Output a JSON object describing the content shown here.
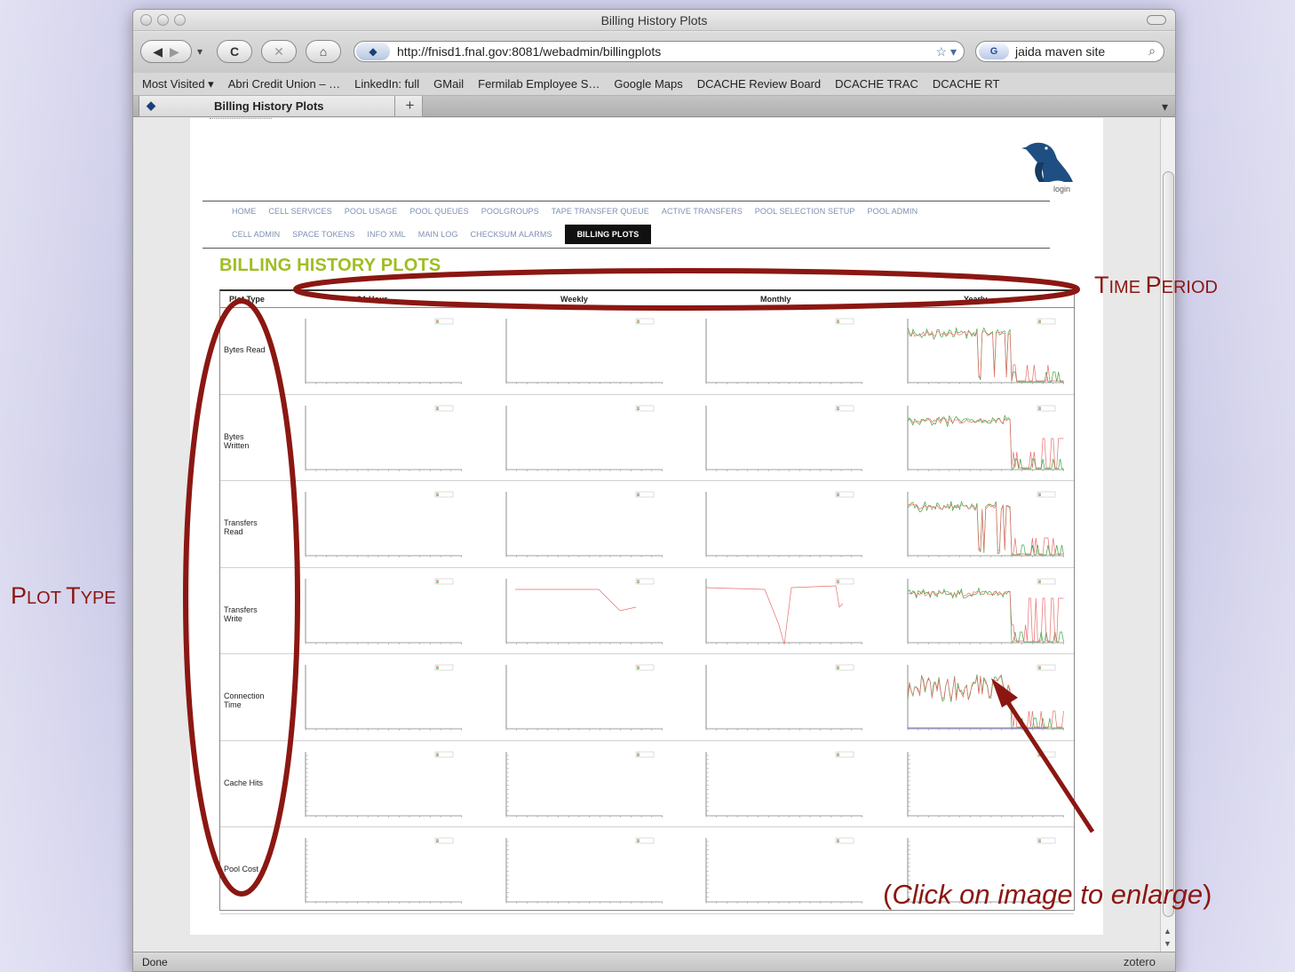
{
  "window": {
    "title": "Billing History Plots"
  },
  "toolbar": {
    "back_glyph": "◀",
    "forward_glyph": "▶",
    "history_glyph": "▾",
    "reload_glyph": "C",
    "stop_glyph": "✕",
    "home_glyph": "⌂",
    "url": "http://fnisd1.fnal.gov:8081/webadmin/billingplots",
    "bookmark_glyph": "☆ ▾",
    "search_engine": "G",
    "search_value": "jaida maven site",
    "search_glyph": "⌕"
  },
  "bookmarks": [
    "Most Visited ▾",
    "Abri Credit Union – …",
    "LinkedIn: full",
    "GMail",
    "Fermilab Employee S…",
    "Google Maps",
    "DCACHE Review Board",
    "DCACHE TRAC",
    "DCACHE RT"
  ],
  "tab": {
    "label": "Billing History Plots",
    "new_tab": "+",
    "menu_glyph": "▾"
  },
  "statusbar": {
    "left": "Done",
    "right": "zotero"
  },
  "page": {
    "login": "login",
    "nav_row1": [
      "HOME",
      "CELL SERVICES",
      "POOL USAGE",
      "POOL QUEUES",
      "POOLGROUPS",
      "TAPE TRANSFER QUEUE",
      "ACTIVE TRANSFERS",
      "POOL SELECTION SETUP",
      "POOL ADMIN"
    ],
    "nav_row2": [
      "CELL ADMIN",
      "SPACE TOKENS",
      "INFO XML",
      "MAIN LOG",
      "CHECKSUM ALARMS",
      "BILLING PLOTS"
    ],
    "active_nav": "BILLING PLOTS",
    "heading": "BILLING HISTORY PLOTS",
    "table": {
      "columns": [
        "Plot Type",
        "24-Hour",
        "Weekly",
        "Monthly",
        "Yearly"
      ],
      "rows": [
        "Bytes Read",
        "Bytes\nWritten",
        "Transfers\nRead",
        "Transfers\nWrite",
        "Connection\nTime",
        "Cache Hits",
        "Pool Cost"
      ]
    }
  },
  "annotations": {
    "time_period_t": "T",
    "time_period_rest1": "IME ",
    "time_period_p": "P",
    "time_period_rest2": "ERIOD",
    "plot_type_p": "P",
    "plot_type_rest1": "LOT ",
    "plot_type_t": "T",
    "plot_type_rest2": "YPE",
    "click_open": "(",
    "click_text": "Click on image to enlarge",
    "click_close": ")"
  },
  "colors": {
    "annotation": "#8b1712",
    "heading": "#9ebe22",
    "nav": "#7f8fb3",
    "series_red": "#e86e6e",
    "series_green": "#3fa83f",
    "series_blue": "#5b5bd6"
  }
}
